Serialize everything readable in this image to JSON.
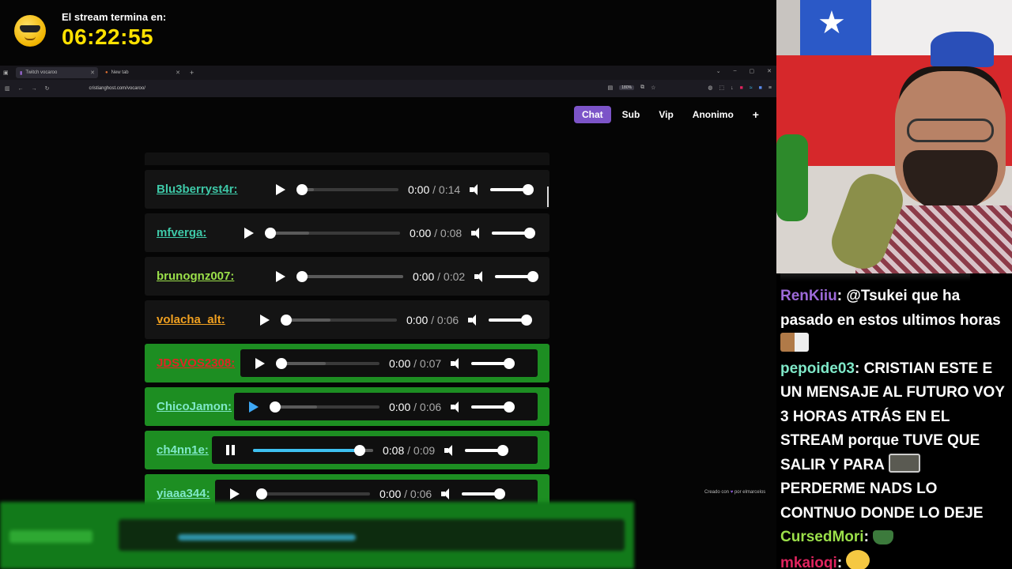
{
  "overlay": {
    "timer_label": "El stream termina en:",
    "timer_value": "06:22:55"
  },
  "browser": {
    "tabs": [
      {
        "label": "Twitch vocaroo",
        "active": true
      },
      {
        "label": "New tab",
        "active": false
      }
    ],
    "url": "cristianghost.com/vocaroo/",
    "zoom": "180%"
  },
  "filters": {
    "items": [
      "Chat",
      "Sub",
      "Vip",
      "Anonimo",
      "+"
    ],
    "active": "Chat"
  },
  "entries": [
    {
      "name": "Blu3berryst4r:",
      "name_color": "#3ec9a8",
      "state": "play",
      "current": "0:00",
      "duration": "0:14",
      "progress": 0,
      "buffered": 0.12,
      "green": false
    },
    {
      "name": "mfverga:",
      "name_color": "#3ec9a8",
      "state": "play",
      "current": "0:00",
      "duration": "0:08",
      "progress": 0,
      "buffered": 0.3,
      "green": false
    },
    {
      "name": "brunognz007:",
      "name_color": "#9be04a",
      "state": "play",
      "current": "0:00",
      "duration": "0:02",
      "progress": 0,
      "buffered": 1.0,
      "green": false
    },
    {
      "name": "volacha_alt:",
      "name_color": "#f0a020",
      "state": "play",
      "current": "0:00",
      "duration": "0:06",
      "progress": 0,
      "buffered": 0.4,
      "green": false
    },
    {
      "name": "JDSVOS2308:",
      "name_color": "#e02424",
      "state": "play",
      "current": "0:00",
      "duration": "0:07",
      "progress": 0,
      "buffered": 0.45,
      "green": true
    },
    {
      "name": "ChicoJamon:",
      "name_color": "#7fe8c8",
      "state": "play-hover",
      "current": "0:00",
      "duration": "0:06",
      "progress": 0,
      "buffered": 0.4,
      "green": true
    },
    {
      "name": "ch4nn1e:",
      "name_color": "#7fe8c8",
      "state": "pause",
      "current": "0:08",
      "duration": "0:09",
      "progress": 0.89,
      "buffered": 1.0,
      "green": true
    },
    {
      "name": "yiaaa344:",
      "name_color": "#7fe8c8",
      "state": "play",
      "current": "0:00",
      "duration": "0:06",
      "progress": 0.05,
      "buffered": 0.05,
      "green": true
    }
  ],
  "credit": {
    "prefix": "Creado con",
    "suffix": "por elmarcelos"
  },
  "chat": [
    {
      "user": "RenKiiu",
      "color": "#9d6ad8",
      "text": ": @Tsukei que ha pasado en estos ultimos horas",
      "emote": "cat"
    },
    {
      "user": "pepoide03",
      "color": "#7fe8c8",
      "text": ": CRISTIAN ESTE E UN MENSAJE AL FUTURO VOY 3 HORAS ATRÁS EN EL STREAM porque TUVE QUE SALIR Y PARA",
      "emote": "man",
      "text2": "PERDERME NADS LO CONTNUO DONDE LO DEJE"
    },
    {
      "user": "CursedMori",
      "color": "#9be04a",
      "text": ":",
      "emote": "boat"
    },
    {
      "user": "mkaioqi",
      "color": "#e0245e",
      "text": ":",
      "emote": "face"
    }
  ]
}
